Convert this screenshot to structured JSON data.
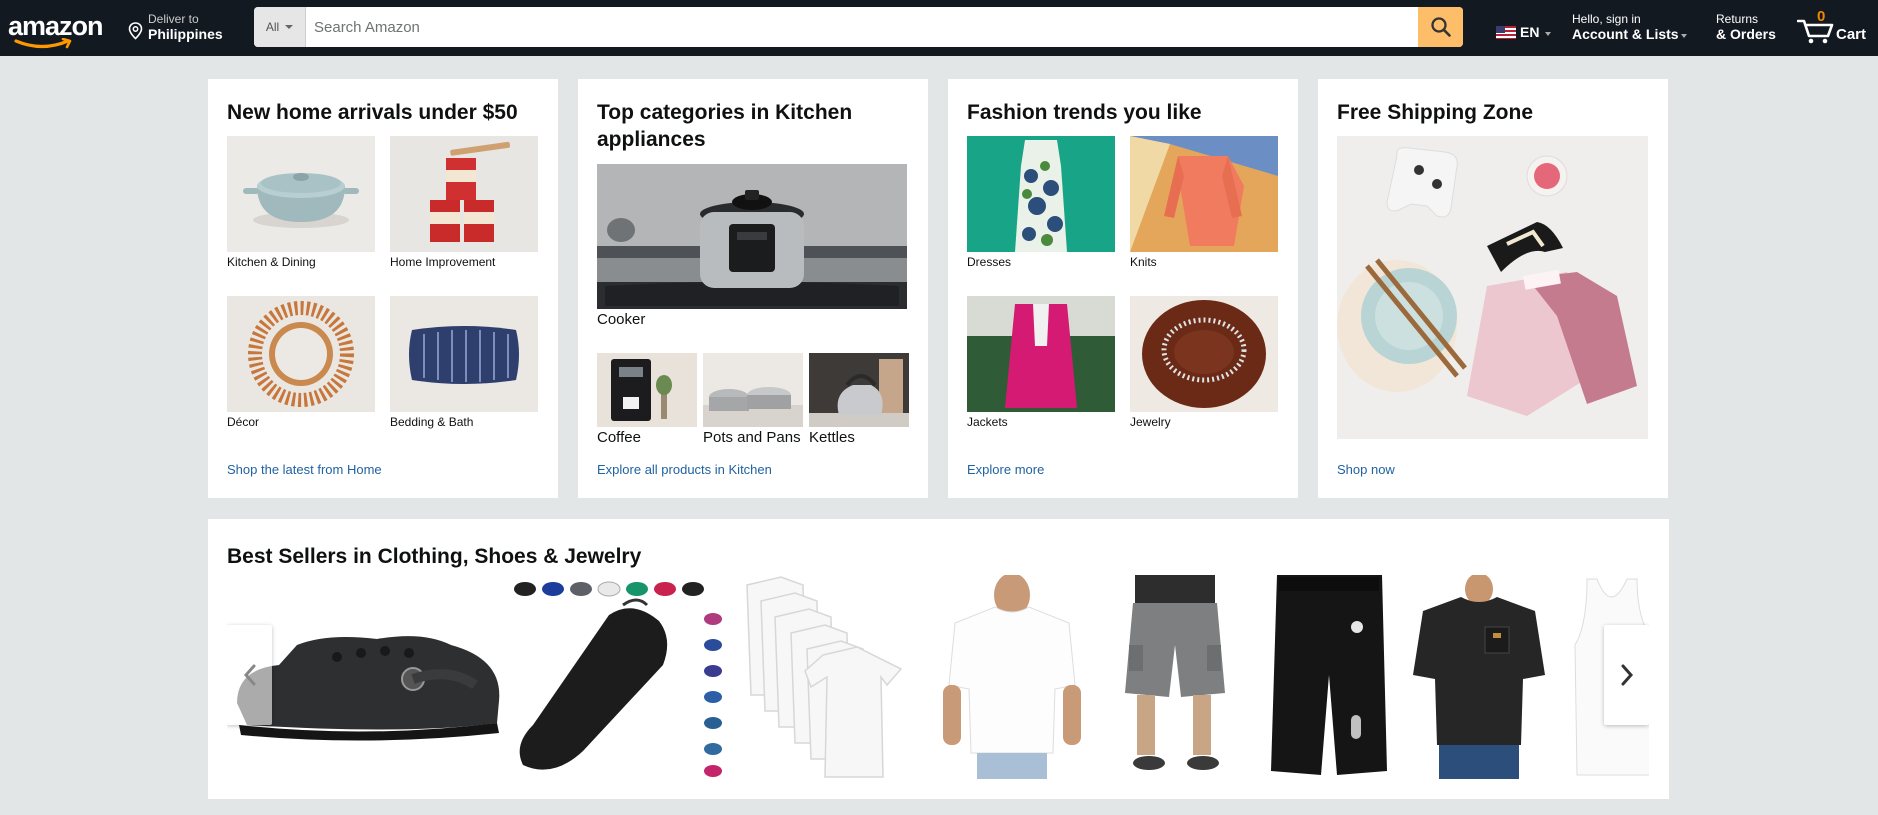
{
  "header": {
    "logo": "amazon",
    "deliver_label": "Deliver to",
    "deliver_location": "Philippines",
    "search_category": "All",
    "search_placeholder": "Search Amazon",
    "language": "EN",
    "account_greeting": "Hello, sign in",
    "account_label": "Account & Lists",
    "returns_label": "Returns",
    "orders_label": "& Orders",
    "cart_count": "0",
    "cart_label": "Cart"
  },
  "cards": {
    "home": {
      "title": "New home arrivals under $50",
      "tiles": [
        "Kitchen & Dining",
        "Home Improvement",
        "Décor",
        "Bedding & Bath"
      ],
      "link": "Shop the latest from Home"
    },
    "kitchen": {
      "title_line1": "Top categories in Kitchen",
      "title_line2": "appliances",
      "main_caption": "Cooker",
      "tiles": [
        "Coffee",
        "Pots and Pans",
        "Kettles"
      ],
      "link": "Explore all products in Kitchen"
    },
    "fashion": {
      "title": "Fashion trends you like",
      "tiles": [
        "Dresses",
        "Knits",
        "Jackets",
        "Jewelry"
      ],
      "link": "Explore more"
    },
    "shipping": {
      "title": "Free Shipping Zone",
      "link": "Shop now"
    }
  },
  "best_sellers": {
    "title": "Best Sellers in Clothing, Shoes & Jewelry",
    "products": [
      "clog",
      "water-shoes",
      "tshirt-pack",
      "white-tshirt",
      "cargo-shorts",
      "athletic-shorts",
      "pocket-tshirt",
      "tank-top"
    ]
  },
  "colors": {
    "nav_bg": "#131921",
    "search_button": "#febd69",
    "link": "#2162a1",
    "cart_count": "#f08804",
    "page_bg": "#e3e6e6"
  }
}
